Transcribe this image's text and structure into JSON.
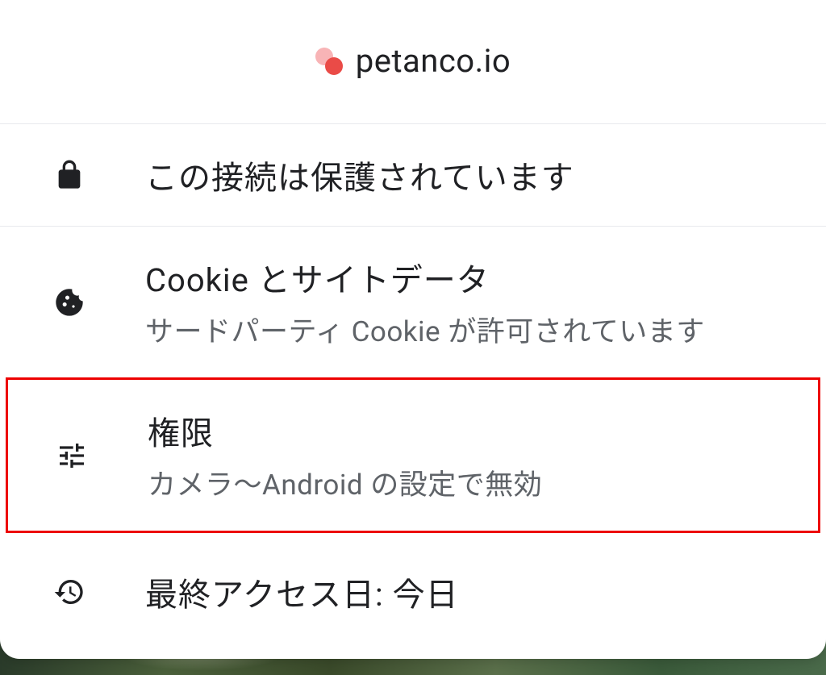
{
  "header": {
    "site_name": "petanco.io"
  },
  "rows": {
    "connection": {
      "title": "この接続は保護されています"
    },
    "cookies": {
      "title": "Cookie とサイトデータ",
      "subtitle": "サードパーティ Cookie が許可されています"
    },
    "permissions": {
      "title": "権限",
      "subtitle": "カメラ～Android の設定で無効"
    },
    "last_access": {
      "title": "最終アクセス日: 今日"
    }
  }
}
